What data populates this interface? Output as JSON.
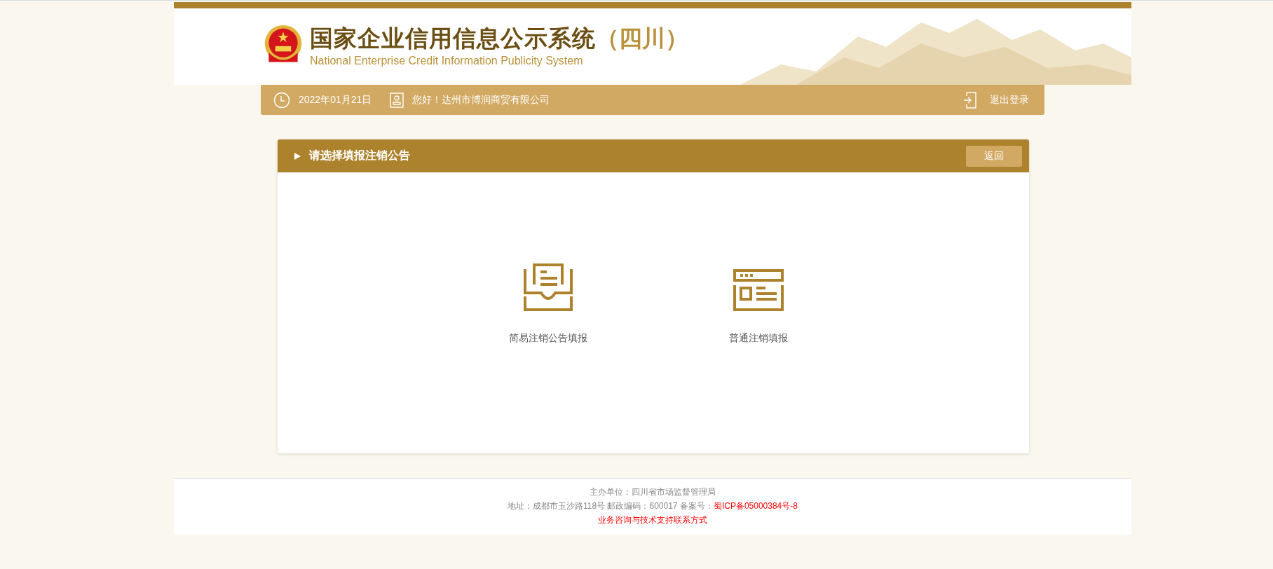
{
  "header": {
    "title": "国家企业信用信息公示系统",
    "region": "（四川）",
    "subtitle": "National Enterprise Credit Information Publicity System"
  },
  "info_bar": {
    "date": "2022年01月21日",
    "greeting": "您好！达州市博润商贸有限公司",
    "logout": "退出登录"
  },
  "panel": {
    "title": "请选择填报注销公告",
    "back_button": "返回",
    "options": [
      {
        "kind": "inbox",
        "label": "简易注销公告填报"
      },
      {
        "kind": "browser",
        "label": "普通注销填报"
      }
    ]
  },
  "footer": {
    "organizer": "主办单位：四川省市场监督管理局",
    "address": "地址：成都市玉沙路118号 邮政编码：600017 备案号：",
    "icp_link": "蜀ICP备05000384号-8",
    "contact_link": "业务咨询与技术支持联系方式"
  }
}
